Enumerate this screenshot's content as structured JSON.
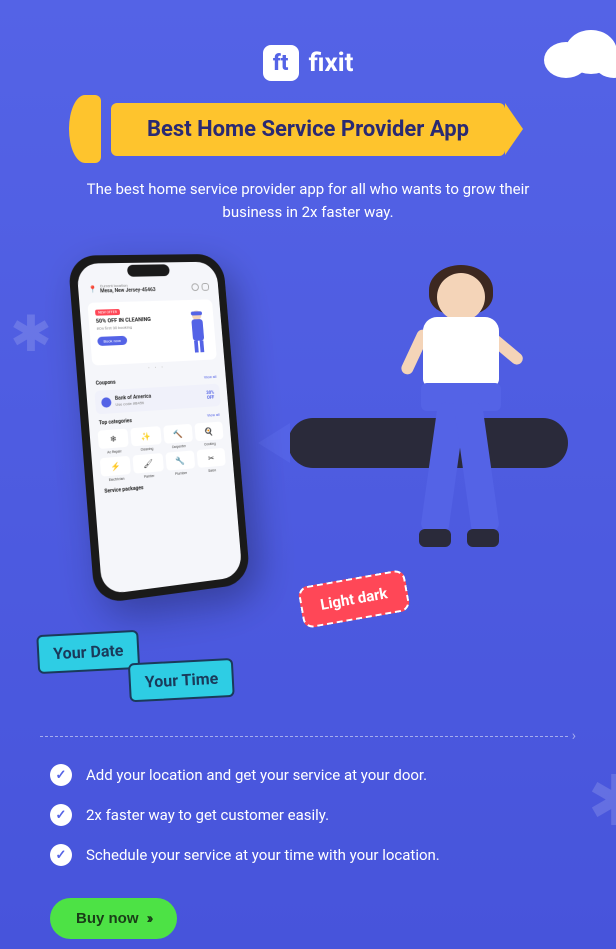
{
  "logo": {
    "icon_text": "ft",
    "brand": "fixit"
  },
  "hero": {
    "title": "Best Home Service Provider App",
    "subtitle": "The best home service provider app for all who wants to grow their business in 2x faster way."
  },
  "phone": {
    "location_label": "Current location",
    "location_value": "Mesa, New Jersey-45463",
    "offer_tag": "NEW OFFER",
    "offer_title": "50% OFF IN CLEANING",
    "offer_sub": "#On first 30 booking",
    "offer_btn": "Book now",
    "coupons_title": "Coupons",
    "coupons_link": "View all",
    "coupon_name": "Bank of America",
    "coupon_code": "Use code #B456",
    "coupon_off_pct": "30%",
    "coupon_off_label": "OFF",
    "categories_title": "Top categories",
    "categories_link": "View all",
    "categories": [
      {
        "icon": "❄",
        "label": "Ac Repair"
      },
      {
        "icon": "✨",
        "label": "Cleaning"
      },
      {
        "icon": "🔨",
        "label": "Carpenter"
      },
      {
        "icon": "🍳",
        "label": "Cooking"
      },
      {
        "icon": "⚡",
        "label": "Electrician"
      },
      {
        "icon": "🖌",
        "label": "Painter"
      },
      {
        "icon": "🔧",
        "label": "Plumber"
      },
      {
        "icon": "✂",
        "label": "Salon"
      }
    ],
    "packages_title": "Service packages"
  },
  "badges": {
    "light_dark": "Light dark",
    "date_line1": "Your Date",
    "date_line2": "Your Time"
  },
  "features": [
    "Add your location and get your service at your door.",
    "2x faster way to get customer easily.",
    "Schedule your service at your time with your location."
  ],
  "cta": {
    "buy": "Buy now"
  }
}
